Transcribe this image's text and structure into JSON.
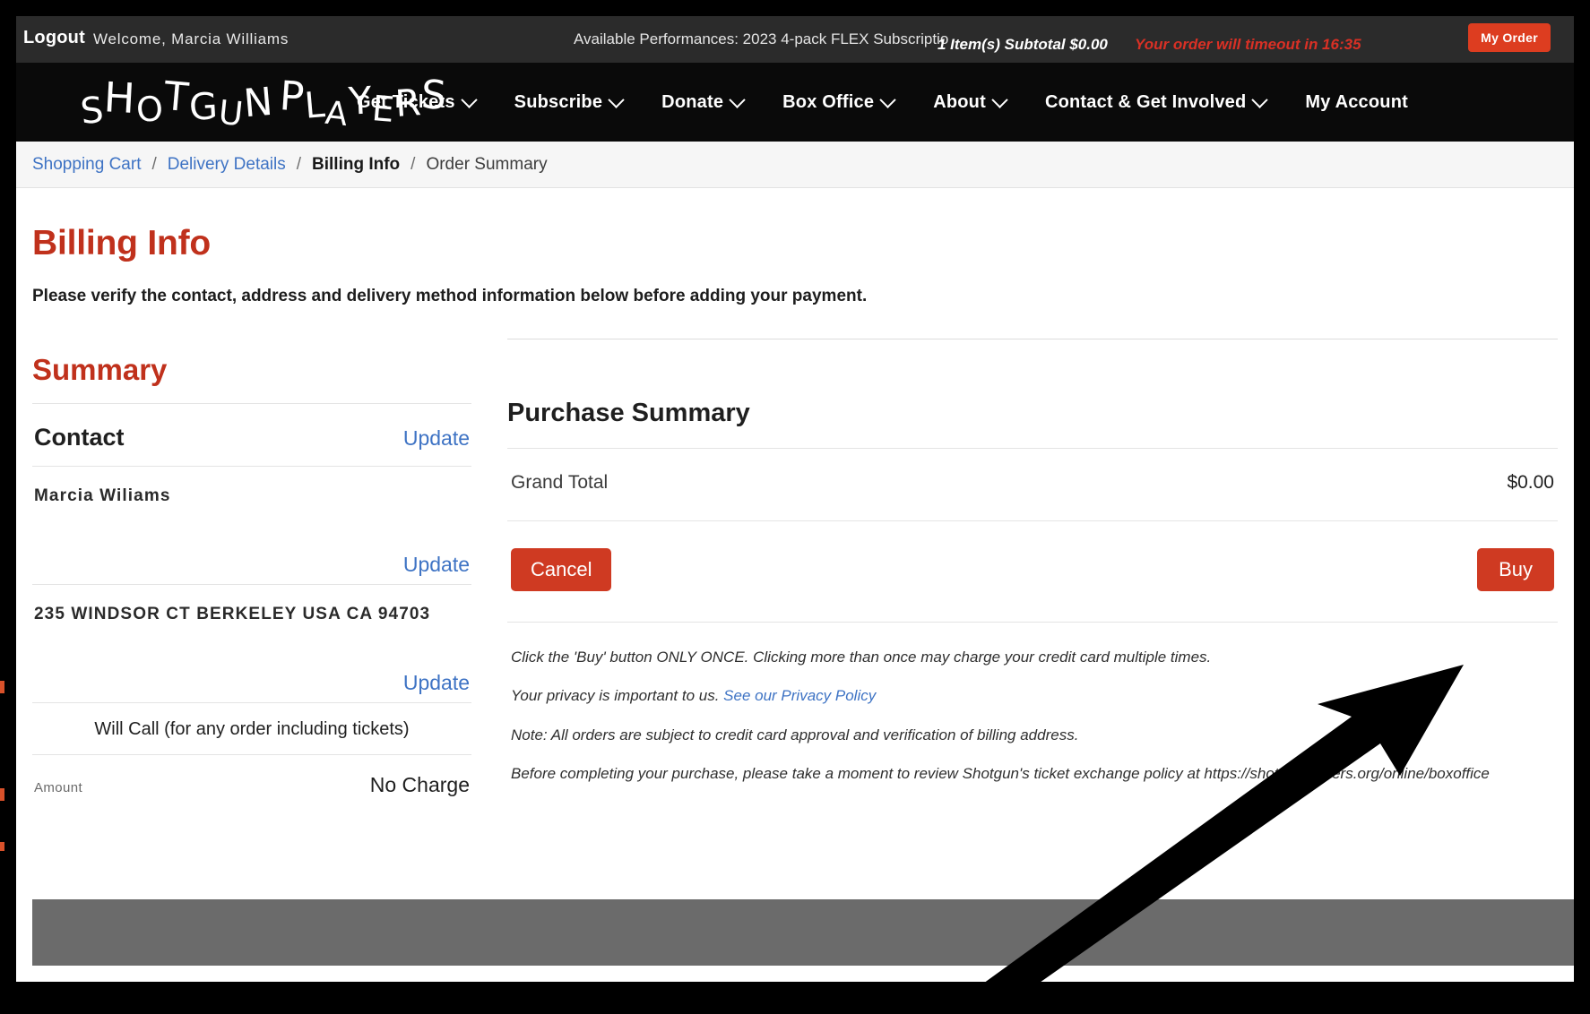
{
  "utility_bar": {
    "logout_label": "Logout",
    "welcome_text": "Welcome, Marcia Williams",
    "available_performances": "Available Performances: 2023 4-pack FLEX Subscriptio",
    "cart_subtotal": "1 Item(s) Subtotal $0.00",
    "timeout_text": "Your order will timeout in 16:35",
    "my_order_label": "My Order",
    "timeout_color": "#d93025",
    "accent_color": "#dd3d20"
  },
  "nav": {
    "brand": "SHOTGUN PLAYERS",
    "brand_letters": [
      "S",
      "H",
      "O",
      "T",
      "G",
      "U",
      "N",
      " ",
      "P",
      "L",
      "A",
      "Y",
      "E",
      "R",
      "S"
    ],
    "items": [
      {
        "label": "Get Tickets",
        "has_caret": true
      },
      {
        "label": "Subscribe",
        "has_caret": true
      },
      {
        "label": "Donate",
        "has_caret": true
      },
      {
        "label": "Box Office",
        "has_caret": true
      },
      {
        "label": "About",
        "has_caret": true
      },
      {
        "label": "Contact & Get Involved",
        "has_caret": true
      },
      {
        "label": "My Account",
        "has_caret": false
      }
    ]
  },
  "breadcrumb": {
    "items": [
      {
        "label": "Shopping Cart",
        "state": "link"
      },
      {
        "label": "Delivery Details",
        "state": "link"
      },
      {
        "label": "Billing Info",
        "state": "current"
      },
      {
        "label": "Order Summary",
        "state": "plain"
      }
    ],
    "separator": "/"
  },
  "page": {
    "title": "Billing Info",
    "title_color": "#c0311c",
    "subtitle": "Please verify the contact, address and delivery method information below before adding your payment."
  },
  "summary": {
    "heading": "Summary",
    "contact": {
      "section_label": "Contact",
      "update_label": "Update",
      "value": "Marcia Wiliams"
    },
    "address": {
      "update_label": "Update",
      "value": "235 WINDSOR CT BERKELEY USA CA 94703"
    },
    "delivery": {
      "update_label": "Update",
      "value": "Will Call (for any order including tickets)"
    },
    "amount": {
      "label": "Amount",
      "value": "No Charge"
    }
  },
  "purchase": {
    "heading": "Purchase Summary",
    "grand_total_label": "Grand Total",
    "grand_total_value": "$0.00",
    "cancel_label": "Cancel",
    "buy_label": "Buy",
    "button_color": "#cf3a22",
    "fineprint": [
      {
        "text": "Click the 'Buy' button ONLY ONCE. Clicking more than once may charge your credit card multiple times.",
        "link": null
      },
      {
        "text": "Your privacy is important to us. ",
        "link": "See our Privacy Policy"
      },
      {
        "text": "Note: All orders are subject to credit card approval and verification of billing address.",
        "link": null
      },
      {
        "text": "Before completing your purchase, please take a moment to review Shotgun's ticket exchange policy at https://shotgunplayers.org/online/boxoffice",
        "link": null
      }
    ]
  }
}
